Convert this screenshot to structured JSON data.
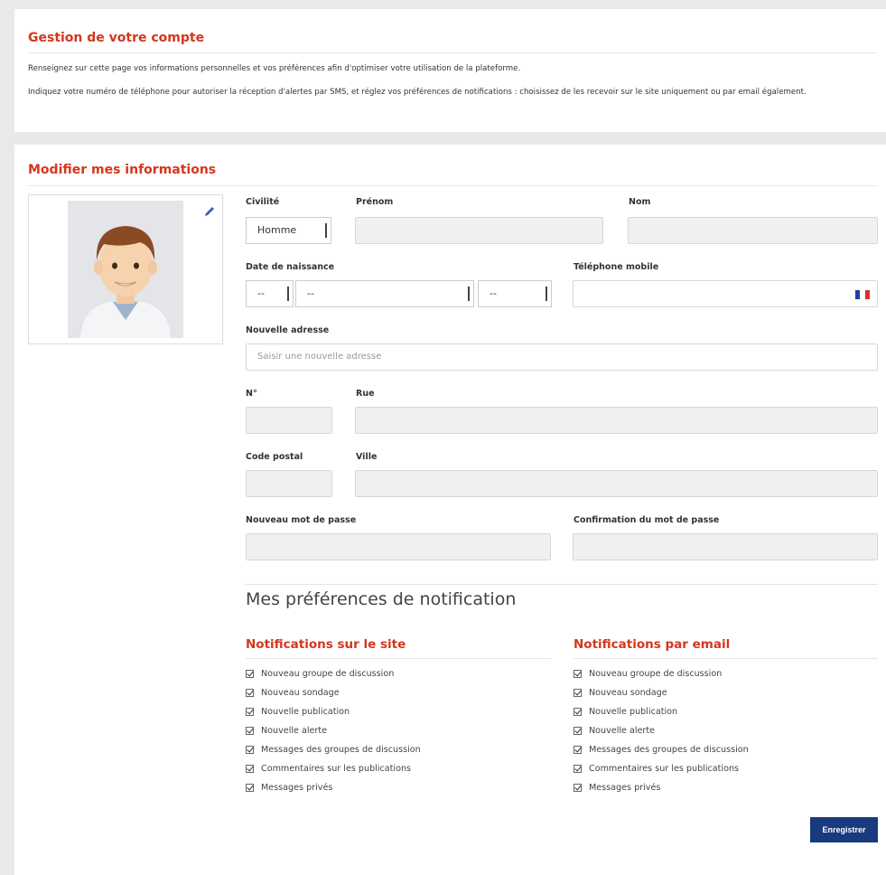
{
  "account": {
    "title": "Gestion de votre compte",
    "intro1": "Renseignez sur cette page vos informations personnelles et vos préférences afin d'optimiser votre utilisation de la plateforme.",
    "intro2": "Indiquez votre numéro de téléphone pour autoriser la réception d'alertes par SMS, et réglez vos préférences de notifications : choisissez de les recevoir sur le site uniquement ou par email également."
  },
  "form": {
    "title": "Modifier mes informations",
    "civilite_label": "Civilité",
    "civilite_value": "Homme",
    "prenom_label": "Prénom",
    "nom_label": "Nom",
    "dob_label": "Date de naissance",
    "dob_day": "--",
    "dob_month": "--",
    "dob_year": "--",
    "phone_label": "Téléphone mobile",
    "address_label": "Nouvelle adresse",
    "address_placeholder": "Saisir une nouvelle adresse",
    "numero_label": "N°",
    "rue_label": "Rue",
    "cp_label": "Code postal",
    "ville_label": "Ville",
    "pwd_label": "Nouveau mot de passe",
    "pwd_confirm_label": "Confirmation du mot de passe"
  },
  "preferences": {
    "title": "Mes préférences de notification",
    "site_title": "Notifications sur le site",
    "email_title": "Notifications par email",
    "site_items": [
      "Nouveau groupe de discussion",
      "Nouveau sondage",
      "Nouvelle publication",
      "Nouvelle alerte",
      "Messages des groupes de discussion",
      "Commentaires sur les publications",
      "Messages privés"
    ],
    "email_items": [
      "Nouveau groupe de discussion",
      "Nouveau sondage",
      "Nouvelle publication",
      "Nouvelle alerte",
      "Messages des groupes de discussion",
      "Commentaires sur les publications",
      "Messages privés"
    ]
  },
  "save_label": "Enregistrer",
  "colors": {
    "accent": "#d5361d",
    "button": "#1a3a80"
  }
}
